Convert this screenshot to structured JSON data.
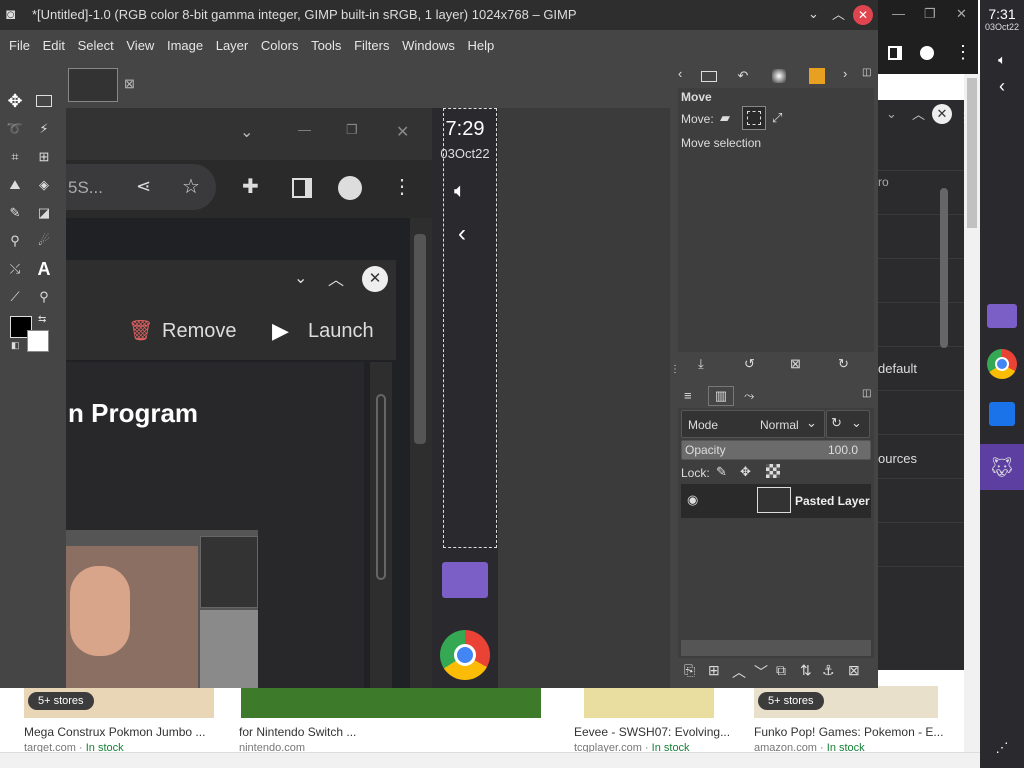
{
  "gimp": {
    "title": "*[Untitled]-1.0 (RGB color 8-bit gamma integer, GIMP built-in sRGB, 1 layer) 1024x768 – GIMP",
    "menus": [
      "File",
      "Edit",
      "Select",
      "View",
      "Image",
      "Layer",
      "Colors",
      "Tools",
      "Filters",
      "Windows",
      "Help"
    ],
    "tool_options": {
      "title": "Move",
      "move_label": "Move:",
      "mode_text": "Move selection"
    },
    "layers": {
      "mode_label": "Mode",
      "mode_value": "Normal",
      "opacity_label": "Opacity",
      "opacity_value": "100.0",
      "lock_label": "Lock:",
      "layer_name": "Pasted Layer"
    }
  },
  "screenshot": {
    "omnibox_text": "5S...",
    "remove_label": "Remove",
    "launch_label": "Launch",
    "heading": "n Program",
    "clock_time": "7:29",
    "clock_date": "03Oct22"
  },
  "background": {
    "partial_rows": [
      "ro",
      "default",
      "ources"
    ],
    "products": [
      {
        "badge": "5+ stores",
        "title": "Mega Construx Pokmon Jumbo ...",
        "source": "target.com",
        "stock": "In stock"
      },
      {
        "badge": "",
        "title": "for Nintendo Switch ...",
        "source": "nintendo.com",
        "stock": ""
      },
      {
        "badge": "",
        "title": "Eevee - SWSH07: Evolving...",
        "source": "tcgplayer.com",
        "stock": "In stock"
      },
      {
        "badge": "5+ stores",
        "title": "Funko Pop! Games: Pokemon - E...",
        "source": "amazon.com",
        "stock": "In stock"
      }
    ]
  },
  "system": {
    "clock_time": "7:31",
    "clock_date": "03Oct22"
  },
  "colors": {
    "gimp_bg": "#454545",
    "titlebar": "#2e2e2e",
    "close_red": "#e0454f"
  }
}
